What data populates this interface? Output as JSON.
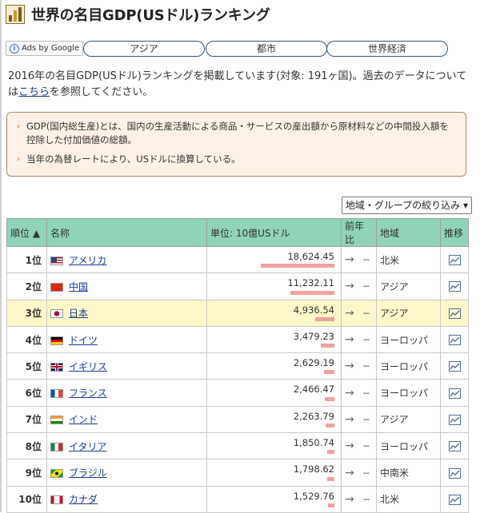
{
  "header": {
    "title": "世界の名目GDP(USドル)ランキング"
  },
  "nav": {
    "ads_label": "Ads by Google",
    "links": [
      "アジア",
      "都市",
      "世界経済"
    ]
  },
  "intro": {
    "text": "2016年の名目GDP(USドル)ランキングを掲載しています(対象: 191ヶ国)。過去のデータについては",
    "link": "こちら",
    "tail": "を参照してください。"
  },
  "notes": [
    "GDP(国内総生産)とは、国内の生産活動による商品・サービスの産出額から原材料などの中間投入額を控除した付加価値の総額。",
    "当年の為替レートにより、USドルに換算している。"
  ],
  "filter": {
    "label": "地域・グループの絞り込み ▾"
  },
  "table": {
    "headers": {
      "rank": "順位 ▲",
      "name": "名称",
      "gdp": "単位: 10億USドル",
      "change": "前年比",
      "region": "地域",
      "chart": "推移"
    },
    "rows": [
      {
        "rank": "1位",
        "name": "アメリカ",
        "gdp": "18,624.45",
        "value": 18624.45,
        "trend": "→",
        "diff": "−",
        "region": "北米",
        "flag": "us"
      },
      {
        "rank": "2位",
        "name": "中国",
        "gdp": "11,232.11",
        "value": 11232.11,
        "trend": "→",
        "diff": "−",
        "region": "アジア",
        "flag": "cn"
      },
      {
        "rank": "3位",
        "name": "日本",
        "gdp": "4,936.54",
        "value": 4936.54,
        "trend": "→",
        "diff": "−",
        "region": "アジア",
        "flag": "jp",
        "highlight": true
      },
      {
        "rank": "4位",
        "name": "ドイツ",
        "gdp": "3,479.23",
        "value": 3479.23,
        "trend": "→",
        "diff": "−",
        "region": "ヨーロッパ",
        "flag": "de"
      },
      {
        "rank": "5位",
        "name": "イギリス",
        "gdp": "2,629.19",
        "value": 2629.19,
        "trend": "→",
        "diff": "−",
        "region": "ヨーロッパ",
        "flag": "gb"
      },
      {
        "rank": "6位",
        "name": "フランス",
        "gdp": "2,466.47",
        "value": 2466.47,
        "trend": "→",
        "diff": "−",
        "region": "ヨーロッパ",
        "flag": "fr"
      },
      {
        "rank": "7位",
        "name": "インド",
        "gdp": "2,263.79",
        "value": 2263.79,
        "trend": "→",
        "diff": "−",
        "region": "アジア",
        "flag": "in"
      },
      {
        "rank": "8位",
        "name": "イタリア",
        "gdp": "1,850.74",
        "value": 1850.74,
        "trend": "→",
        "diff": "−",
        "region": "ヨーロッパ",
        "flag": "it"
      },
      {
        "rank": "9位",
        "name": "ブラジル",
        "gdp": "1,798.62",
        "value": 1798.62,
        "trend": "→",
        "diff": "−",
        "region": "中南米",
        "flag": "br"
      },
      {
        "rank": "10位",
        "name": "カナダ",
        "gdp": "1,529.76",
        "value": 1529.76,
        "trend": "→",
        "diff": "−",
        "region": "北米",
        "flag": "ca"
      }
    ]
  },
  "colors": {
    "header_bg": "#8fd4b8",
    "highlight_row": "#fef8c8",
    "bar": "#f2a0a0",
    "link": "#1a3c9a"
  }
}
